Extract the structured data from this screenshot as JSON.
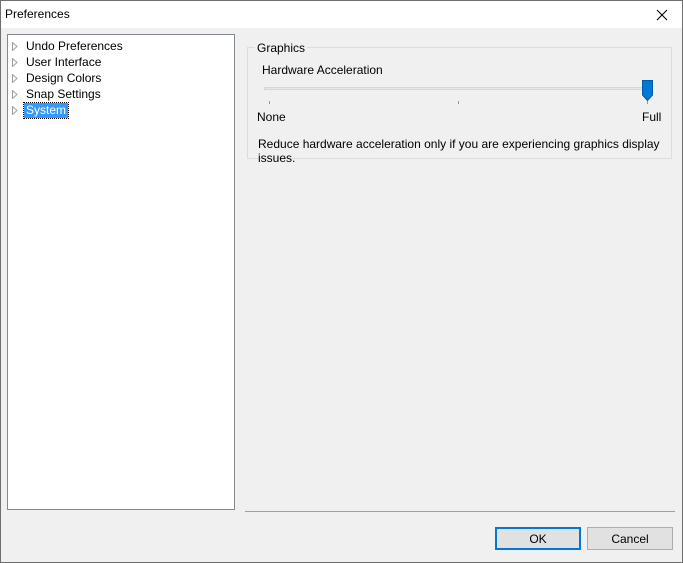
{
  "window": {
    "title": "Preferences"
  },
  "tree": {
    "items": [
      {
        "label": "Undo Preferences",
        "selected": false
      },
      {
        "label": "User Interface",
        "selected": false
      },
      {
        "label": "Design Colors",
        "selected": false
      },
      {
        "label": "Snap Settings",
        "selected": false
      },
      {
        "label": "System",
        "selected": true
      }
    ]
  },
  "graphics": {
    "group_title": "Graphics",
    "slider_label": "Hardware Acceleration",
    "slider_min_label": "None",
    "slider_max_label": "Full",
    "slider_level": 1.0,
    "description": "Reduce hardware acceleration only if you are experiencing graphics display issues."
  },
  "buttons": {
    "ok": "OK",
    "cancel": "Cancel"
  },
  "colors": {
    "selection": "#3399ff",
    "accent": "#0078d7",
    "window_bg": "#f0f0f0"
  }
}
